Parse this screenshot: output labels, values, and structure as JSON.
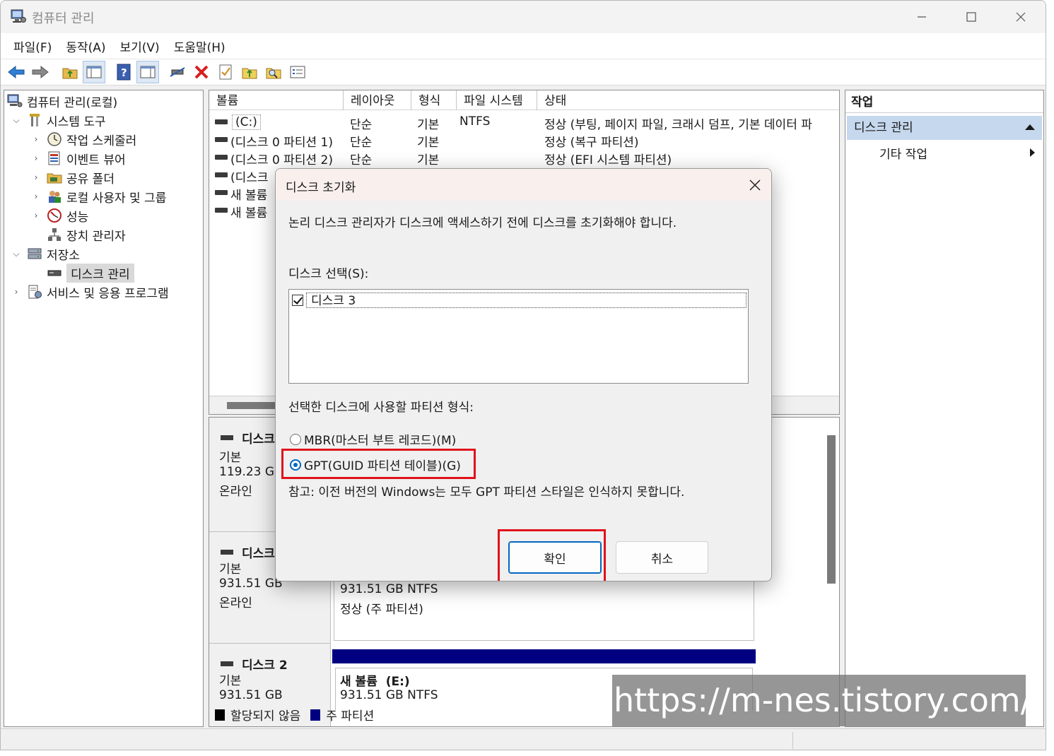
{
  "window": {
    "title": "컴퓨터 관리"
  },
  "menu": [
    "파일(F)",
    "동작(A)",
    "보기(V)",
    "도움말(H)"
  ],
  "tree": {
    "root": "컴퓨터 관리(로컬)",
    "system_tools": "시스템 도구",
    "task_scheduler": "작업 스케줄러",
    "event_viewer": "이벤트 뷰어",
    "shared_folders": "공유 폴더",
    "local_users": "로컬 사용자 및 그룹",
    "performance": "성능",
    "device_manager": "장치 관리자",
    "storage": "저장소",
    "disk_management": "디스크 관리",
    "services": "서비스 및 응용 프로그램"
  },
  "volumes": {
    "columns": [
      "볼륨",
      "레이아웃",
      "형식",
      "파일 시스템",
      "상태"
    ],
    "rows": [
      {
        "name": "(C:)",
        "layout": "단순",
        "type": "기본",
        "fs": "NTFS",
        "status": "정상 (부팅, 페이지 파일, 크래시 덤프, 기본 데이터 파"
      },
      {
        "name": "(디스크 0 파티션 1)",
        "layout": "단순",
        "type": "기본",
        "fs": "",
        "status": "정상 (복구 파티션)"
      },
      {
        "name": "(디스크 0 파티션 2)",
        "layout": "단순",
        "type": "기본",
        "fs": "",
        "status": "정상 (EFI 시스템 파티션)"
      },
      {
        "name": "(디스크",
        "layout": "",
        "type": "",
        "fs": "",
        "status": ""
      },
      {
        "name": "새 볼륨",
        "layout": "",
        "type": "",
        "fs": "",
        "status": ""
      },
      {
        "name": "새 볼륨",
        "layout": "",
        "type": "",
        "fs": "",
        "status": ""
      }
    ]
  },
  "disks": [
    {
      "name": "디스크",
      "kind": "기본",
      "size": "119.23 GB",
      "state": "온라인"
    },
    {
      "name": "디스크",
      "kind": "기본",
      "size": "931.51 GB",
      "state": "온라인",
      "part_size": "931.51 GB NTFS",
      "part_status": "정상 (주 파티션)"
    },
    {
      "name": "디스크 2",
      "kind": "기본",
      "size": "931.51 GB",
      "part_name": "새 볼륨",
      "part_letter": "(E:)",
      "part_size": "931.51 GB NTFS"
    }
  ],
  "legend": {
    "unallocated": "할당되지 않음",
    "primary": "주 파티션"
  },
  "actions": {
    "header": "작업",
    "section": "디스크 관리",
    "item": "기타 작업"
  },
  "dialog": {
    "title": "디스크 초기화",
    "message": "논리 디스크 관리자가 디스크에 액세스하기 전에 디스크를 초기화해야 합니다.",
    "select_label": "디스크 선택(S):",
    "disk_item": "디스크 3",
    "partition_label": "선택한 디스크에 사용할 파티션 형식:",
    "mbr_label": "MBR(마스터 부트 레코드)(M)",
    "gpt_label": "GPT(GUID 파티션 테이블)(G)",
    "note": "참고: 이전 버전의 Windows는 모두 GPT 파티션 스타일은 인식하지 못합니다.",
    "ok": "확인",
    "cancel": "취소"
  },
  "watermark": "https://m-nes.tistory.com/",
  "colors": {
    "primary_partition": "#000080",
    "highlight": "#e0121c",
    "accent": "#0067c0",
    "selection": "#c6d8ee"
  }
}
